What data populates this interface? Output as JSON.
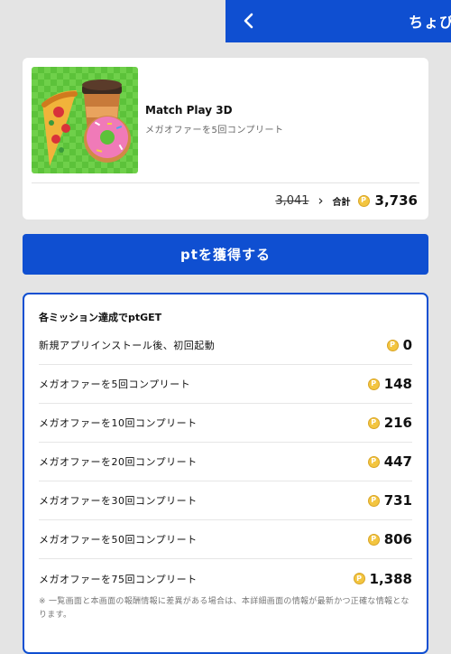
{
  "header": {
    "title": "ちょびリッチ"
  },
  "app": {
    "name": "Match Play 3D",
    "subtitle": "メガオファーを5回コンプリート",
    "old_points": "3,041",
    "total_label": "合計",
    "total_points": "3,736"
  },
  "coin_symbol": "P",
  "earn_button": "ptを獲得する",
  "missions": {
    "title": "各ミッション達成でptGET",
    "items": [
      {
        "label": "新規アプリインストール後、初回起動",
        "points": "0"
      },
      {
        "label": "メガオファーを5回コンプリート",
        "points": "148"
      },
      {
        "label": "メガオファーを10回コンプリート",
        "points": "216"
      },
      {
        "label": "メガオファーを20回コンプリート",
        "points": "447"
      },
      {
        "label": "メガオファーを30回コンプリート",
        "points": "731"
      },
      {
        "label": "メガオファーを50回コンプリート",
        "points": "806"
      },
      {
        "label": "メガオファーを75回コンプリート",
        "points": "1,388"
      }
    ],
    "disclaimer": "※ 一覧画面と本画面の報酬情報に差異がある場合は、本詳細画面の情報が最新かつ正確な情報となります。"
  },
  "colors": {
    "brand_blue": "#0f4fd1",
    "coin_gold": "#f3c540",
    "background": "#e4e4e4"
  }
}
